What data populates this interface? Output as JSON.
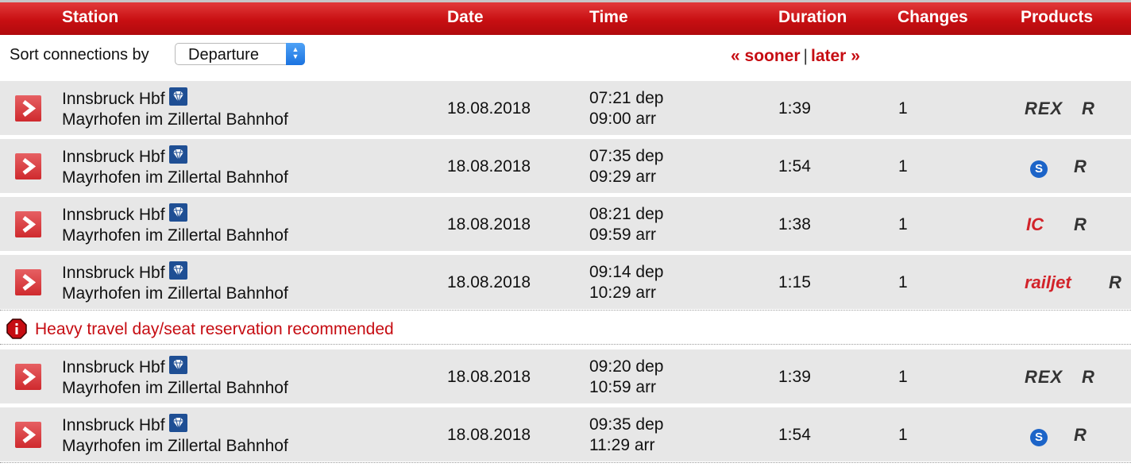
{
  "header": {
    "station": "Station",
    "date": "Date",
    "time": "Time",
    "duration": "Duration",
    "changes": "Changes",
    "products": "Products"
  },
  "sort": {
    "label": "Sort connections by",
    "selected": "Departure"
  },
  "paging": {
    "sooner": "« sooner",
    "separator": "|",
    "later": "later »"
  },
  "notice": {
    "text": "Heavy travel day/seat reservation recommended"
  },
  "connections": [
    {
      "from": "Innsbruck Hbf",
      "to": "Mayrhofen im Zillertal Bahnhof",
      "date": "18.08.2018",
      "dep": "07:21 dep",
      "arr": "09:00 arr",
      "duration": "1:39",
      "changes": "1",
      "product1": "REX",
      "product2": "R"
    },
    {
      "from": "Innsbruck Hbf",
      "to": "Mayrhofen im Zillertal Bahnhof",
      "date": "18.08.2018",
      "dep": "07:35 dep",
      "arr": "09:29 arr",
      "duration": "1:54",
      "changes": "1",
      "product1": "S",
      "product2": "R"
    },
    {
      "from": "Innsbruck Hbf",
      "to": "Mayrhofen im Zillertal Bahnhof",
      "date": "18.08.2018",
      "dep": "08:21 dep",
      "arr": "09:59 arr",
      "duration": "1:38",
      "changes": "1",
      "product1": "IC",
      "product2": "R"
    },
    {
      "from": "Innsbruck Hbf",
      "to": "Mayrhofen im Zillertal Bahnhof",
      "date": "18.08.2018",
      "dep": "09:14 dep",
      "arr": "10:29 arr",
      "duration": "1:15",
      "changes": "1",
      "product1": "railjet",
      "product2": "R"
    },
    {
      "from": "Innsbruck Hbf",
      "to": "Mayrhofen im Zillertal Bahnhof",
      "date": "18.08.2018",
      "dep": "09:20 dep",
      "arr": "10:59 arr",
      "duration": "1:39",
      "changes": "1",
      "product1": "REX",
      "product2": "R"
    },
    {
      "from": "Innsbruck Hbf",
      "to": "Mayrhofen im Zillertal Bahnhof",
      "date": "18.08.2018",
      "dep": "09:35 dep",
      "arr": "11:29 arr",
      "duration": "1:54",
      "changes": "1",
      "product1": "S",
      "product2": "R"
    }
  ],
  "colors": {
    "brand_red": "#c80f12",
    "row_bg": "#e7e7e7",
    "sbahn_blue": "#1c64c8",
    "station_icon": "#1f4f94"
  },
  "icons": {
    "row_arrow": "chevron-right-icon",
    "station_info": "diamond-icon",
    "notice": "alert-icon"
  }
}
